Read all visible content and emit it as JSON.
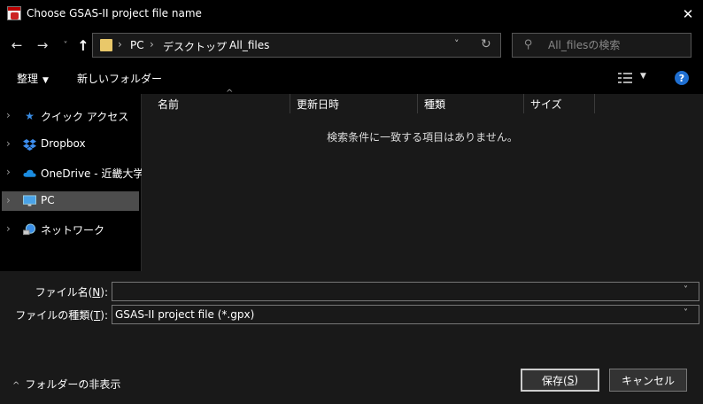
{
  "window": {
    "title": "Choose GSAS-II project file name",
    "close_glyph": "✕"
  },
  "nav": {
    "back_glyph": "←",
    "forward_glyph": "→",
    "recent_glyph": "˅",
    "up_glyph": "↑",
    "breadcrumb": [
      "PC",
      "デスクトップ",
      "All_files"
    ],
    "separator": "›",
    "dropdown_glyph": "˅",
    "refresh_glyph": "↻",
    "search_placeholder": "All_filesの検索"
  },
  "toolbar": {
    "organize_label": "整理",
    "new_folder_label": "新しいフォルダー",
    "help_label": "?"
  },
  "tree": {
    "items": [
      {
        "label": "クイック アクセス",
        "icon": "star-icon"
      },
      {
        "label": "Dropbox",
        "icon": "dropbox-icon"
      },
      {
        "label": "OneDrive - 近畿大学",
        "icon": "cloud-icon"
      },
      {
        "label": "PC",
        "icon": "monitor-icon",
        "selected": true
      },
      {
        "label": "ネットワーク",
        "icon": "network-icon"
      }
    ]
  },
  "columns": [
    "名前",
    "更新日時",
    "種類",
    "サイズ"
  ],
  "empty_message": "検索条件に一致する項目はありません。",
  "filename": {
    "label_text": "ファイル名(",
    "label_key": "N",
    "label_end": "):",
    "value": ""
  },
  "filetype": {
    "label_text": "ファイルの種類(",
    "label_key": "T",
    "label_end": "):",
    "value": "GSAS-II project file (*.gpx)"
  },
  "footer": {
    "hide_folders_label": "フォルダーの非表示",
    "save_text": "保存(",
    "save_key": "S",
    "save_end": ")",
    "cancel_label": "キャンセル"
  },
  "colors": {
    "selected_bg": "#4d4d4d",
    "folder": "#e9c86a",
    "help": "#1f6fd1",
    "accent_blue": "#3a8ee6"
  }
}
